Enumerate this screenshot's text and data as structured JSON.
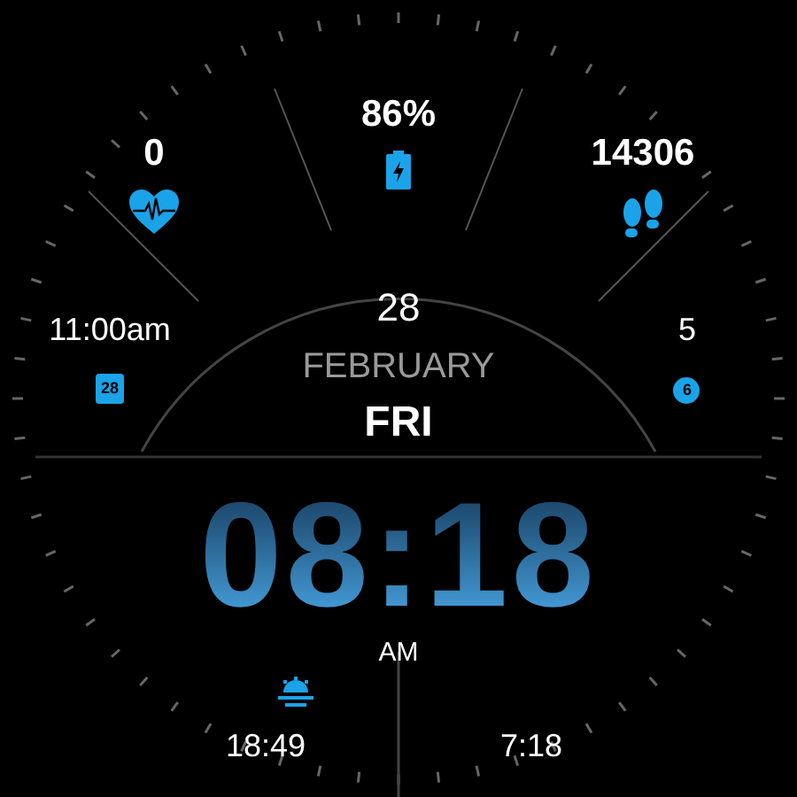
{
  "top": [
    {
      "kind": "heart",
      "value": "0"
    },
    {
      "kind": "battery",
      "value": "86%"
    },
    {
      "kind": "steps",
      "value": "14306"
    }
  ],
  "left": {
    "kind": "calendar",
    "value": "11:00am",
    "badge": "28"
  },
  "date": {
    "day": "28",
    "month": "FEBRUARY",
    "weekday": "FRI"
  },
  "right": {
    "kind": "notifications",
    "value": "5",
    "badge": "6"
  },
  "time": {
    "clock": "08:18",
    "period": "AM"
  },
  "sun": {
    "sunset": "18:49",
    "sunrise": "7:18"
  }
}
